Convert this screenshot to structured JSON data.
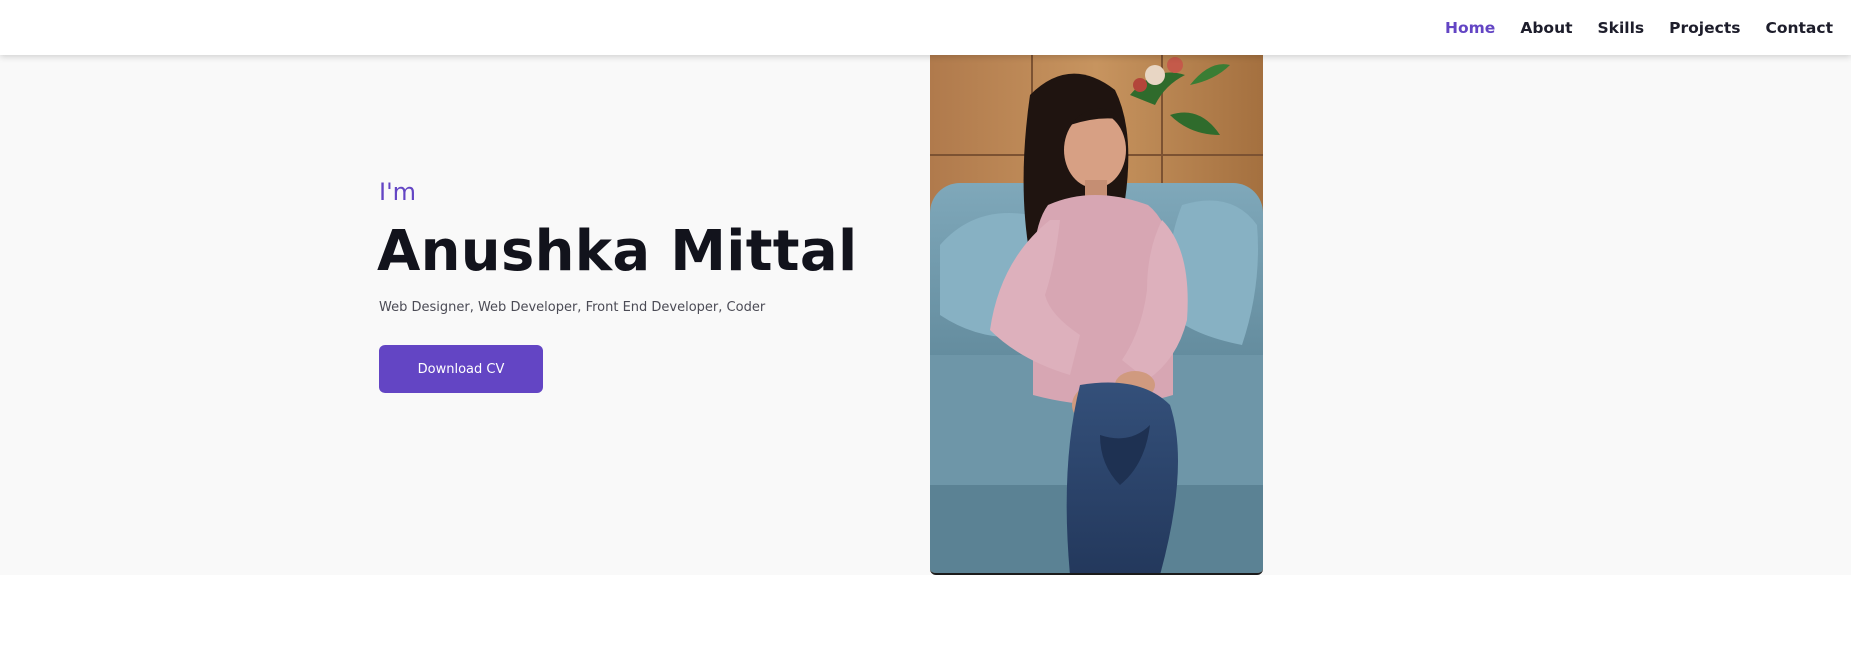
{
  "nav": {
    "items": [
      {
        "label": "Home",
        "active": true
      },
      {
        "label": "About",
        "active": false
      },
      {
        "label": "Skills",
        "active": false
      },
      {
        "label": "Projects",
        "active": false
      },
      {
        "label": "Contact",
        "active": false
      }
    ]
  },
  "hero": {
    "greeting": "I'm",
    "name": "Anushka Mittal",
    "roles": "Web Designer, Web Developer, Front End Developer, Coder",
    "cv_button_label": "Download CV"
  },
  "colors": {
    "accent": "#6345c4",
    "heading": "#12131c",
    "hero_background": "#f9f9f9",
    "nav_text": "#1d1d2b"
  },
  "photo": {
    "subject": "portrait-photo"
  }
}
